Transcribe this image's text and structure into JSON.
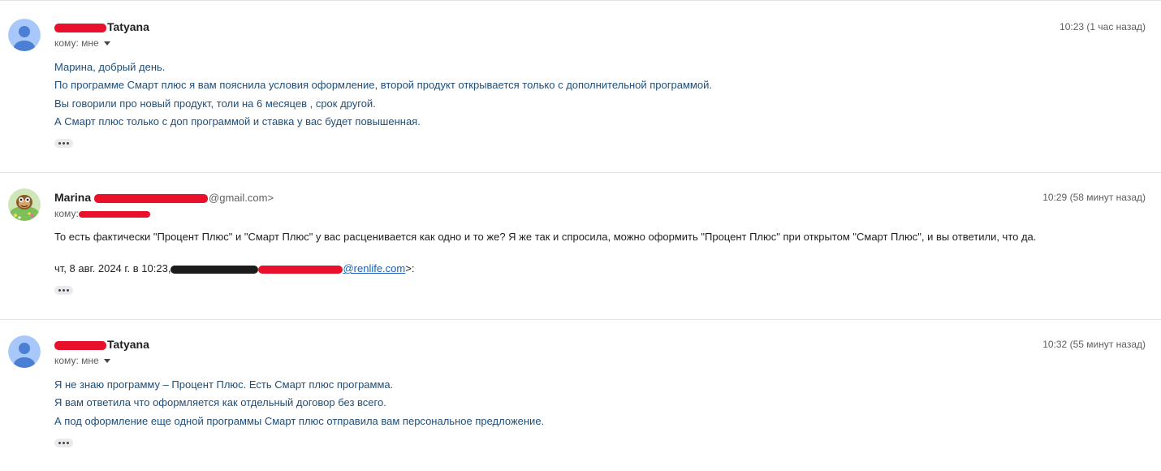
{
  "messages": [
    {
      "sender_name": "Tatyana",
      "recipient_label": "кому: мне",
      "time": "10:23 (1 час назад)",
      "body": [
        "Марина, добрый день.",
        "По программе Смарт плюс я вам пояснила условия оформление, второй продукт открывается только с дополнительной программой.",
        "Вы говорили про новый продукт, толи на 6 месяцев , срок другой.",
        "А Смарт плюс только с доп программой и ставка у вас будет повышенная."
      ]
    },
    {
      "sender_name": "Marina",
      "sender_address_visible": "@gmail.com>",
      "recipient_label": "кому:",
      "time": "10:29 (58 минут назад)",
      "body": [
        "То есть фактически \"Процент Плюс\" и \"Смарт Плюс\" у вас расценивается как одно и то же? Я же так и спросила, можно оформить \"Процент Плюс\" при открытом \"Смарт Плюс\", и вы ответили, что да."
      ],
      "quote_prefix": "чт, 8 авг. 2024 г. в 10:23,",
      "quote_email_visible": "@renlife.com",
      "quote_suffix": ">:"
    },
    {
      "sender_name": "Tatyana",
      "recipient_label": "кому: мне",
      "time": "10:32 (55 минут назад)",
      "body": [
        "Я не знаю программу – Процент Плюс. Есть Смарт плюс программа.",
        "Я вам ответила что оформляется как отдельный договор без всего.",
        "А под оформление еще одной программы Смарт плюс отправила вам персональное предложение."
      ]
    }
  ],
  "icons": {
    "default_avatar": "person-avatar-icon",
    "marina_avatar": "cartoon-avatar-icon",
    "recipient_dropdown": "caret-down-icon",
    "show_trimmed": "ellipsis-icon"
  },
  "colors": {
    "avatar_bg": "#a8c7fa",
    "avatar_fg": "#4a7fd4",
    "body_text_blue": "#1f4e79",
    "link": "#1a5fb4",
    "redaction_red": "#e8102a",
    "redaction_black": "#1b1b1b"
  }
}
